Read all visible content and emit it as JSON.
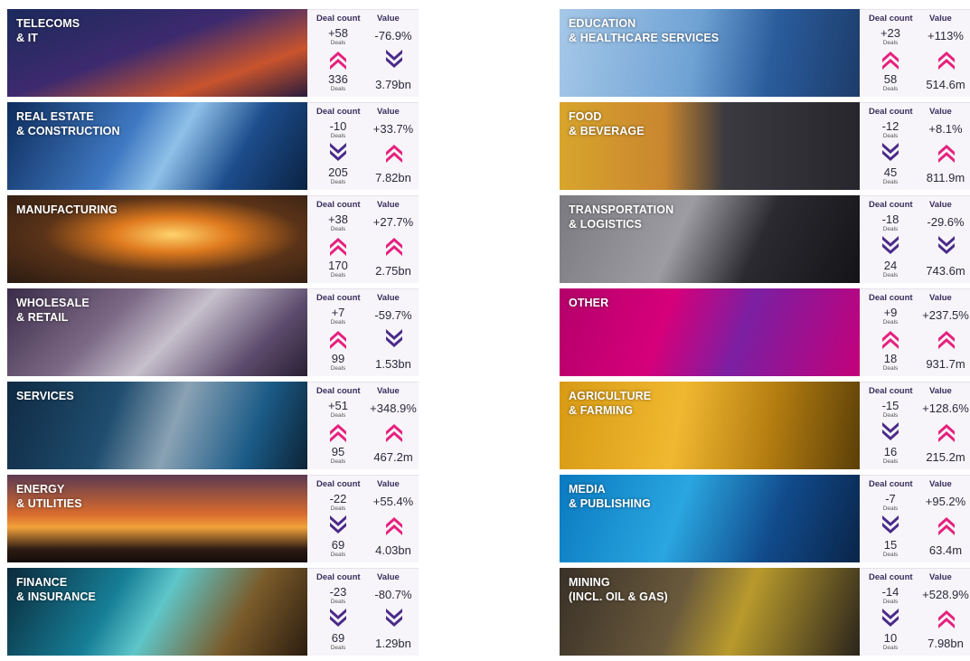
{
  "colors": {
    "up_arrow": "#e6207e",
    "down_arrow": "#4a2a8a",
    "header_text": "#3a2d5c"
  },
  "labels": {
    "deal_count": "Deal count",
    "value": "Value",
    "deals": "Deals"
  },
  "left": [
    {
      "name": "TELECOMS\n& IT",
      "deal_change": "+58",
      "deal_dir": "up",
      "value_change": "-76.9%",
      "value_dir": "down",
      "deals": "336",
      "value": "3.79bn"
    },
    {
      "name": "REAL ESTATE\n& CONSTRUCTION",
      "deal_change": "-10",
      "deal_dir": "down",
      "value_change": "+33.7%",
      "value_dir": "up",
      "deals": "205",
      "value": "7.82bn"
    },
    {
      "name": "MANUFACTURING",
      "deal_change": "+38",
      "deal_dir": "up",
      "value_change": "+27.7%",
      "value_dir": "up",
      "deals": "170",
      "value": "2.75bn"
    },
    {
      "name": "WHOLESALE\n& RETAIL",
      "deal_change": "+7",
      "deal_dir": "up",
      "value_change": "-59.7%",
      "value_dir": "down",
      "deals": "99",
      "value": "1.53bn"
    },
    {
      "name": "SERVICES",
      "deal_change": "+51",
      "deal_dir": "up",
      "value_change": "+348.9%",
      "value_dir": "up",
      "deals": "95",
      "value": "467.2m"
    },
    {
      "name": "ENERGY\n& UTILITIES",
      "deal_change": "-22",
      "deal_dir": "down",
      "value_change": "+55.4%",
      "value_dir": "up",
      "deals": "69",
      "value": "4.03bn"
    },
    {
      "name": "FINANCE\n& INSURANCE",
      "deal_change": "-23",
      "deal_dir": "down",
      "value_change": "-80.7%",
      "value_dir": "down",
      "deals": "69",
      "value": "1.29bn"
    }
  ],
  "right": [
    {
      "name": "EDUCATION\n& HEALTHCARE SERVICES",
      "deal_change": "+23",
      "deal_dir": "up",
      "value_change": "+113%",
      "value_dir": "up",
      "deals": "58",
      "value": "514.6m"
    },
    {
      "name": "FOOD\n& BEVERAGE",
      "deal_change": "-12",
      "deal_dir": "down",
      "value_change": "+8.1%",
      "value_dir": "up",
      "deals": "45",
      "value": "811.9m"
    },
    {
      "name": "TRANSPORTATION\n& LOGISTICS",
      "deal_change": "-18",
      "deal_dir": "down",
      "value_change": "-29.6%",
      "value_dir": "down",
      "deals": "24",
      "value": "743.6m"
    },
    {
      "name": "OTHER",
      "deal_change": "+9",
      "deal_dir": "up",
      "value_change": "+237.5%",
      "value_dir": "up",
      "deals": "18",
      "value": "931.7m"
    },
    {
      "name": "AGRICULTURE\n& FARMING",
      "deal_change": "-15",
      "deal_dir": "down",
      "value_change": "+128.6%",
      "value_dir": "up",
      "deals": "16",
      "value": "215.2m"
    },
    {
      "name": "MEDIA\n& PUBLISHING",
      "deal_change": "-7",
      "deal_dir": "down",
      "value_change": "+95.2%",
      "value_dir": "up",
      "deals": "15",
      "value": "63.4m"
    },
    {
      "name": "MINING\n(INCL. OIL & GAS)",
      "deal_change": "-14",
      "deal_dir": "down",
      "value_change": "+528.9%",
      "value_dir": "up",
      "deals": "10",
      "value": "7.98bn"
    }
  ]
}
